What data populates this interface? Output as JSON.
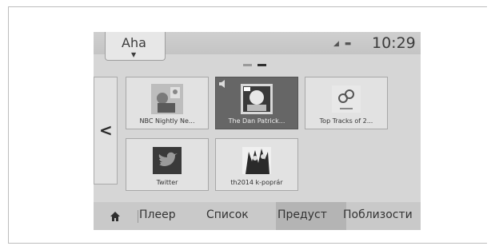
{
  "header": {
    "source_label": "Aha",
    "clock": "10:29"
  },
  "presets": [
    {
      "label": "NBC Nightly Ne...",
      "icon": "nbc-art-icon"
    },
    {
      "label": "The Dan Patrick...",
      "icon": "dan-patrick-art-icon"
    },
    {
      "label": "Top Tracks of 2...",
      "icon": "link-icon"
    },
    {
      "label": "Twitter",
      "icon": "twitter-icon"
    },
    {
      "label": "th2014 k-poprár",
      "icon": "kpop-art-icon"
    }
  ],
  "pagination": {
    "pages": 2,
    "current": 2
  },
  "nav": {
    "player": "Плеер",
    "list": "Список",
    "presets": "Предуст",
    "nearby": "Поблизости"
  },
  "colors": {
    "screen_bg": "#d6d6d6",
    "active_tile": "#666666"
  }
}
